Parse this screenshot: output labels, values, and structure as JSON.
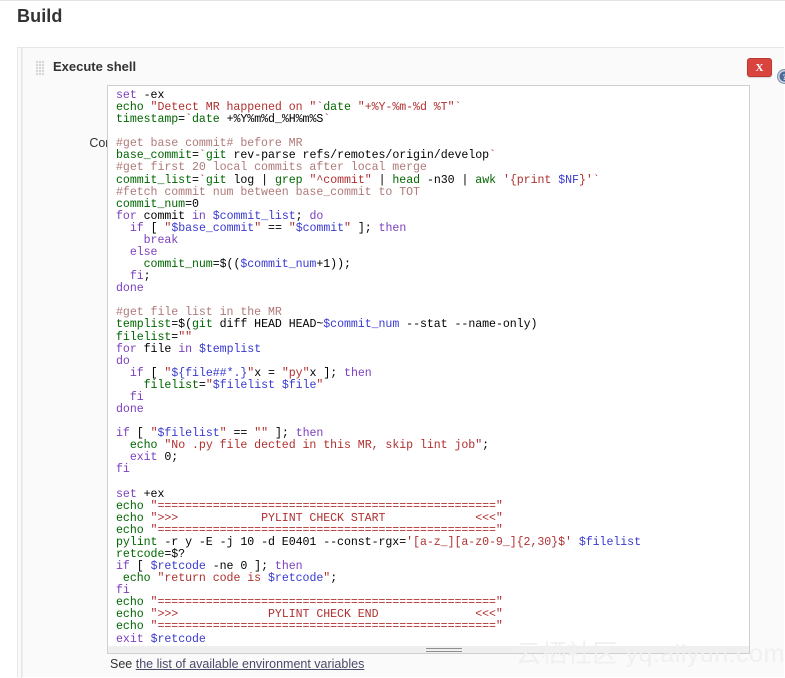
{
  "page": {
    "section_title": "Build",
    "watermark": "云栖社区 yq.aliyun.com"
  },
  "build_step": {
    "name": "Execute shell",
    "delete_label": "X",
    "help_icon": "help-circle-icon",
    "grip_icon": "drag-handle-icon",
    "command_label": "Command",
    "env_note_prefix": "See ",
    "env_note_link": "the list of available environment variables"
  },
  "colors": {
    "delete_button": "#d9443f",
    "help_icon": "#4b6a98",
    "panel_bg": "#fafafa",
    "code_bg": "#ffffff",
    "keyword": "#7b3fbf",
    "builtin": "#006600",
    "string": "#b03030",
    "comment": "#b07a7a",
    "variable": "#3a3ad0",
    "link": "#4a4a6a"
  },
  "command": {
    "script": "set -ex\necho \"Detect MR happened on \"`date \"+%Y-%m-%d %T\"`\ntimestamp=`date +%Y%m%d_%H%m%S`\n\n#get base commit# before MR\nbase_commit=`git rev-parse refs/remotes/origin/develop`\n#get first 20 local commits after local merge\ncommit_list=`git log | grep \"^commit\" | head -n30 | awk '{print $NF}'`\n#fetch commit num between base_commit to TOT\ncommit_num=0\nfor commit in $commit_list; do\n  if [ \"$base_commit\" == \"$commit\" ]; then\n    break\n  else\n    commit_num=$(($commit_num+1));\n  fi;\ndone\n\n#get file list in the MR\ntemplist=$(git diff HEAD HEAD~$commit_num --stat --name-only)\nfilelist=\"\"\nfor file in $templist\ndo\n  if [ \"${file##*.}\"x = \"py\"x ]; then\n    filelist=\"$filelist $file\"\n  fi\ndone\n\nif [ \"$filelist\" == \"\" ]; then\n  echo \"No .py file dected in this MR, skip lint job\";\n  exit 0;\nfi\n\nset +ex\necho \"=================================================\"\necho \">>>            PYLINT CHECK START             <<<\"\necho \"=================================================\"\npylint -r y -E -j 10 -d E0401 --const-rgx='[a-z_][a-z0-9_]{2,30}$' $filelist\nretcode=$?\nif [ $retcode -ne 0 ]; then\n echo \"return code is $retcode\";\nfi\necho \"=================================================\"\necho \">>>             PYLINT CHECK END              <<<\"\necho \"=================================================\"\nexit $retcode",
    "lines": [
      [
        {
          "t": "set",
          "c": "kw"
        },
        {
          "t": " -ex",
          "c": "plain"
        }
      ],
      [
        {
          "t": "echo ",
          "c": "bi"
        },
        {
          "t": "\"Detect MR happened on \"",
          "c": "str"
        },
        {
          "t": "`",
          "c": "str"
        },
        {
          "t": "date ",
          "c": "bi"
        },
        {
          "t": "\"+%Y-%m-%d %T\"",
          "c": "str"
        },
        {
          "t": "`",
          "c": "str"
        }
      ],
      [
        {
          "t": "timestamp",
          "c": "bi"
        },
        {
          "t": "=",
          "c": "plain"
        },
        {
          "t": "`",
          "c": "str"
        },
        {
          "t": "date",
          "c": "bi"
        },
        {
          "t": " +%Y%m%d_%H%m%S",
          "c": "plain"
        },
        {
          "t": "`",
          "c": "str"
        }
      ],
      [],
      [
        {
          "t": "#get base commit# before MR",
          "c": "cmt"
        }
      ],
      [
        {
          "t": "base_commit",
          "c": "bi"
        },
        {
          "t": "=",
          "c": "plain"
        },
        {
          "t": "`",
          "c": "str"
        },
        {
          "t": "git",
          "c": "bi"
        },
        {
          "t": " rev-parse refs/remotes/origin/develop",
          "c": "plain"
        },
        {
          "t": "`",
          "c": "str"
        }
      ],
      [
        {
          "t": "#get first 20 local commits after local merge",
          "c": "cmt"
        }
      ],
      [
        {
          "t": "commit_list",
          "c": "bi"
        },
        {
          "t": "=",
          "c": "plain"
        },
        {
          "t": "`",
          "c": "str"
        },
        {
          "t": "git",
          "c": "bi"
        },
        {
          "t": " log ",
          "c": "plain"
        },
        {
          "t": "|",
          "c": "plain"
        },
        {
          "t": " grep ",
          "c": "bi"
        },
        {
          "t": "\"^commit\"",
          "c": "str"
        },
        {
          "t": " | ",
          "c": "plain"
        },
        {
          "t": "head",
          "c": "bi"
        },
        {
          "t": " -n30 | ",
          "c": "plain"
        },
        {
          "t": "awk",
          "c": "bi"
        },
        {
          "t": " ",
          "c": "plain"
        },
        {
          "t": "'{print ",
          "c": "str"
        },
        {
          "t": "$NF",
          "c": "var"
        },
        {
          "t": "}'",
          "c": "str"
        },
        {
          "t": "`",
          "c": "str"
        }
      ],
      [
        {
          "t": "#fetch commit num between base_commit to TOT",
          "c": "cmt"
        }
      ],
      [
        {
          "t": "commit_num",
          "c": "bi"
        },
        {
          "t": "=0",
          "c": "plain"
        }
      ],
      [
        {
          "t": "for",
          "c": "kw"
        },
        {
          "t": " commit ",
          "c": "plain"
        },
        {
          "t": "in",
          "c": "kw"
        },
        {
          "t": " ",
          "c": "plain"
        },
        {
          "t": "$commit_list",
          "c": "var"
        },
        {
          "t": "; ",
          "c": "plain"
        },
        {
          "t": "do",
          "c": "kw"
        }
      ],
      [
        {
          "t": "  ",
          "c": "plain"
        },
        {
          "t": "if",
          "c": "kw"
        },
        {
          "t": " [ ",
          "c": "plain"
        },
        {
          "t": "\"",
          "c": "str"
        },
        {
          "t": "$base_commit",
          "c": "var"
        },
        {
          "t": "\"",
          "c": "str"
        },
        {
          "t": " == ",
          "c": "plain"
        },
        {
          "t": "\"",
          "c": "str"
        },
        {
          "t": "$commit",
          "c": "var"
        },
        {
          "t": "\"",
          "c": "str"
        },
        {
          "t": " ]; ",
          "c": "plain"
        },
        {
          "t": "then",
          "c": "kw"
        }
      ],
      [
        {
          "t": "    ",
          "c": "plain"
        },
        {
          "t": "break",
          "c": "kw"
        }
      ],
      [
        {
          "t": "  ",
          "c": "plain"
        },
        {
          "t": "else",
          "c": "kw"
        }
      ],
      [
        {
          "t": "    ",
          "c": "plain"
        },
        {
          "t": "commit_num",
          "c": "bi"
        },
        {
          "t": "=$((",
          "c": "plain"
        },
        {
          "t": "$commit_num",
          "c": "var"
        },
        {
          "t": "+1));",
          "c": "plain"
        }
      ],
      [
        {
          "t": "  ",
          "c": "plain"
        },
        {
          "t": "fi",
          "c": "kw"
        },
        {
          "t": ";",
          "c": "plain"
        }
      ],
      [
        {
          "t": "done",
          "c": "kw"
        }
      ],
      [],
      [
        {
          "t": "#get file list in the MR",
          "c": "cmt"
        }
      ],
      [
        {
          "t": "templist",
          "c": "bi"
        },
        {
          "t": "=$(",
          "c": "plain"
        },
        {
          "t": "git",
          "c": "bi"
        },
        {
          "t": " diff HEAD HEAD~",
          "c": "plain"
        },
        {
          "t": "$commit_num",
          "c": "var"
        },
        {
          "t": " --stat --name-only)",
          "c": "plain"
        }
      ],
      [
        {
          "t": "filelist",
          "c": "bi"
        },
        {
          "t": "=",
          "c": "plain"
        },
        {
          "t": "\"\"",
          "c": "str"
        }
      ],
      [
        {
          "t": "for",
          "c": "kw"
        },
        {
          "t": " file ",
          "c": "plain"
        },
        {
          "t": "in",
          "c": "kw"
        },
        {
          "t": " ",
          "c": "plain"
        },
        {
          "t": "$templist",
          "c": "var"
        }
      ],
      [
        {
          "t": "do",
          "c": "kw"
        }
      ],
      [
        {
          "t": "  ",
          "c": "plain"
        },
        {
          "t": "if",
          "c": "kw"
        },
        {
          "t": " [ ",
          "c": "plain"
        },
        {
          "t": "\"",
          "c": "str"
        },
        {
          "t": "${file##*.}",
          "c": "var"
        },
        {
          "t": "\"",
          "c": "str"
        },
        {
          "t": "x = ",
          "c": "plain"
        },
        {
          "t": "\"py\"",
          "c": "str"
        },
        {
          "t": "x ]; ",
          "c": "plain"
        },
        {
          "t": "then",
          "c": "kw"
        }
      ],
      [
        {
          "t": "    ",
          "c": "plain"
        },
        {
          "t": "filelist",
          "c": "bi"
        },
        {
          "t": "=",
          "c": "plain"
        },
        {
          "t": "\"",
          "c": "str"
        },
        {
          "t": "$filelist",
          "c": "var"
        },
        {
          "t": " ",
          "c": "str"
        },
        {
          "t": "$file",
          "c": "var"
        },
        {
          "t": "\"",
          "c": "str"
        }
      ],
      [
        {
          "t": "  ",
          "c": "plain"
        },
        {
          "t": "fi",
          "c": "kw"
        }
      ],
      [
        {
          "t": "done",
          "c": "kw"
        }
      ],
      [],
      [
        {
          "t": "if",
          "c": "kw"
        },
        {
          "t": " [ ",
          "c": "plain"
        },
        {
          "t": "\"",
          "c": "str"
        },
        {
          "t": "$filelist",
          "c": "var"
        },
        {
          "t": "\"",
          "c": "str"
        },
        {
          "t": " == ",
          "c": "plain"
        },
        {
          "t": "\"\"",
          "c": "str"
        },
        {
          "t": " ]; ",
          "c": "plain"
        },
        {
          "t": "then",
          "c": "kw"
        }
      ],
      [
        {
          "t": "  ",
          "c": "plain"
        },
        {
          "t": "echo ",
          "c": "bi"
        },
        {
          "t": "\"No .py file dected in this MR, skip lint job\"",
          "c": "str"
        },
        {
          "t": ";",
          "c": "plain"
        }
      ],
      [
        {
          "t": "  ",
          "c": "plain"
        },
        {
          "t": "exit",
          "c": "kw"
        },
        {
          "t": " 0;",
          "c": "plain"
        }
      ],
      [
        {
          "t": "fi",
          "c": "kw"
        }
      ],
      [],
      [
        {
          "t": "set",
          "c": "kw"
        },
        {
          "t": " +ex",
          "c": "plain"
        }
      ],
      [
        {
          "t": "echo ",
          "c": "bi"
        },
        {
          "t": "\"=================================================\"",
          "c": "str"
        }
      ],
      [
        {
          "t": "echo ",
          "c": "bi"
        },
        {
          "t": "\">>>            PYLINT CHECK START             <<<\"",
          "c": "str"
        }
      ],
      [
        {
          "t": "echo ",
          "c": "bi"
        },
        {
          "t": "\"=================================================\"",
          "c": "str"
        }
      ],
      [
        {
          "t": "pylint",
          "c": "bi"
        },
        {
          "t": " -r y -E -j 10 -d E0401 --const-rgx=",
          "c": "plain"
        },
        {
          "t": "'[a-z_][a-z0-9_]{2,30}$'",
          "c": "str"
        },
        {
          "t": " ",
          "c": "plain"
        },
        {
          "t": "$filelist",
          "c": "var"
        }
      ],
      [
        {
          "t": "retcode",
          "c": "bi"
        },
        {
          "t": "=$?",
          "c": "plain"
        }
      ],
      [
        {
          "t": "if",
          "c": "kw"
        },
        {
          "t": " [ ",
          "c": "plain"
        },
        {
          "t": "$retcode",
          "c": "var"
        },
        {
          "t": " -ne 0 ]; ",
          "c": "plain"
        },
        {
          "t": "then",
          "c": "kw"
        }
      ],
      [
        {
          "t": " ",
          "c": "plain"
        },
        {
          "t": "echo ",
          "c": "bi"
        },
        {
          "t": "\"return code is ",
          "c": "str"
        },
        {
          "t": "$retcode",
          "c": "var"
        },
        {
          "t": "\"",
          "c": "str"
        },
        {
          "t": ";",
          "c": "plain"
        }
      ],
      [
        {
          "t": "fi",
          "c": "kw"
        }
      ],
      [
        {
          "t": "echo ",
          "c": "bi"
        },
        {
          "t": "\"=================================================\"",
          "c": "str"
        }
      ],
      [
        {
          "t": "echo ",
          "c": "bi"
        },
        {
          "t": "\">>>             PYLINT CHECK END              <<<\"",
          "c": "str"
        }
      ],
      [
        {
          "t": "echo ",
          "c": "bi"
        },
        {
          "t": "\"=================================================\"",
          "c": "str"
        }
      ],
      [
        {
          "t": "exit",
          "c": "kw"
        },
        {
          "t": " ",
          "c": "plain"
        },
        {
          "t": "$retcode",
          "c": "var"
        }
      ]
    ]
  }
}
